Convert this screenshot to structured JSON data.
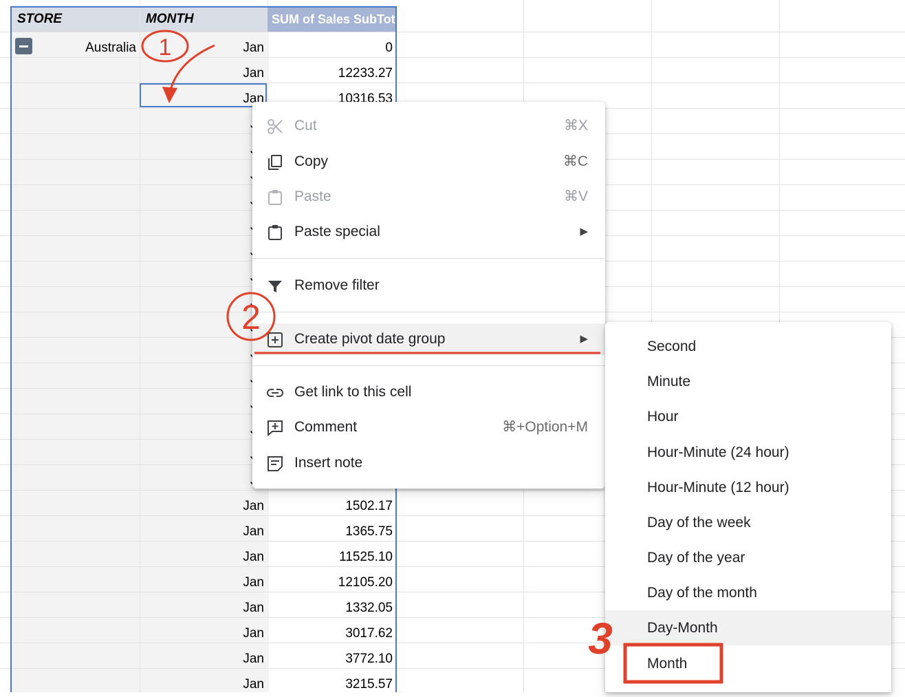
{
  "pivot": {
    "headers": {
      "store": "STORE",
      "month": "MONTH",
      "sum": "SUM of Sales SubTotal"
    },
    "store_value": "Australia",
    "rows": [
      {
        "month": "Jan",
        "value": "0"
      },
      {
        "month": "Jan",
        "value": "12233.27"
      },
      {
        "month": "Jan",
        "value": "10316.53"
      },
      {
        "month": "Ja",
        "value": ""
      },
      {
        "month": "Ja",
        "value": ""
      },
      {
        "month": "Ja",
        "value": ""
      },
      {
        "month": "Ja",
        "value": ""
      },
      {
        "month": "Ja",
        "value": ""
      },
      {
        "month": "Ja",
        "value": ""
      },
      {
        "month": "Ja",
        "value": ""
      },
      {
        "month": "Ja",
        "value": ""
      },
      {
        "month": "Ja",
        "value": ""
      },
      {
        "month": "Ja",
        "value": ""
      },
      {
        "month": "Ja",
        "value": ""
      },
      {
        "month": "Ja",
        "value": ""
      },
      {
        "month": "Ja",
        "value": ""
      },
      {
        "month": "Ja",
        "value": ""
      },
      {
        "month": "Ja",
        "value": ""
      },
      {
        "month": "Jan",
        "value": "1502.17"
      },
      {
        "month": "Jan",
        "value": "1365.75"
      },
      {
        "month": "Jan",
        "value": "11525.10"
      },
      {
        "month": "Jan",
        "value": "12105.20"
      },
      {
        "month": "Jan",
        "value": "1332.05"
      },
      {
        "month": "Jan",
        "value": "3017.62"
      },
      {
        "month": "Jan",
        "value": "3772.10"
      },
      {
        "month": "Jan",
        "value": "3215.57"
      }
    ]
  },
  "context_menu": {
    "cut": {
      "label": "Cut",
      "shortcut": "⌘X"
    },
    "copy": {
      "label": "Copy",
      "shortcut": "⌘C"
    },
    "paste": {
      "label": "Paste",
      "shortcut": "⌘V"
    },
    "paste_special": {
      "label": "Paste special",
      "arrow": "▶"
    },
    "remove_filter": {
      "label": "Remove filter"
    },
    "create_pivot_date_group": {
      "label": "Create pivot date group",
      "arrow": "▶"
    },
    "get_link": {
      "label": "Get link to this cell"
    },
    "comment": {
      "label": "Comment",
      "shortcut": "⌘+Option+M"
    },
    "insert_note": {
      "label": "Insert note"
    }
  },
  "submenu": {
    "items": [
      "Second",
      "Minute",
      "Hour",
      "Hour-Minute (24 hour)",
      "Hour-Minute (12 hour)",
      "Day of the week",
      "Day of the year",
      "Day of the month",
      "Day-Month",
      "Month"
    ],
    "highlighted": "Day-Month"
  },
  "annotations": {
    "step1": "1",
    "step2": "2",
    "step3": "3",
    "color": "#e0412b"
  }
}
